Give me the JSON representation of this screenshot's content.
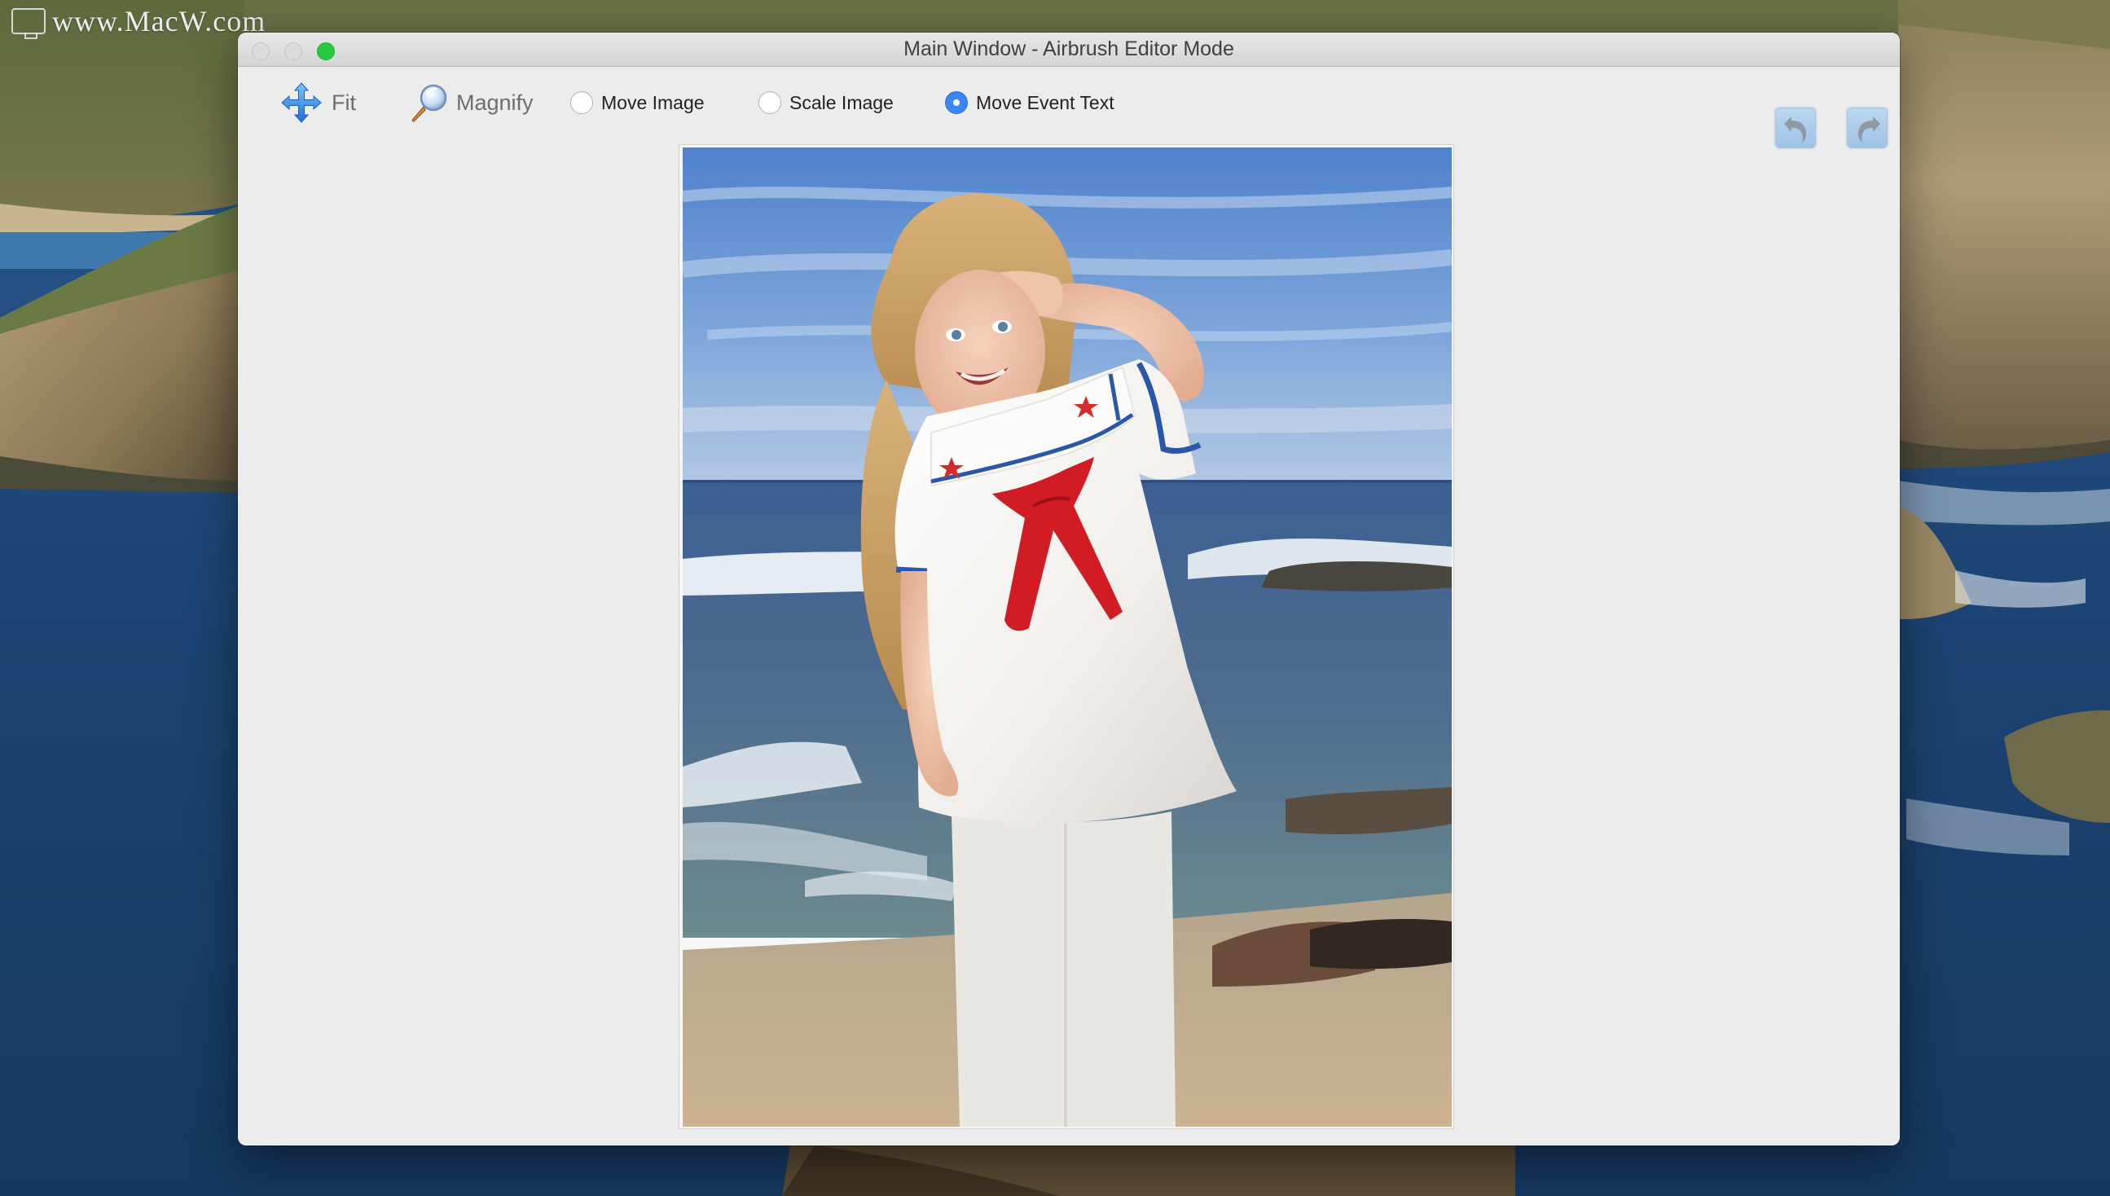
{
  "watermark": {
    "text": "www.MacW.com",
    "icon": "monitor-icon"
  },
  "window": {
    "title": "Main Window - Airbrush Editor Mode",
    "controls": [
      "close",
      "minimize",
      "zoom"
    ]
  },
  "toolbar": {
    "fit": {
      "label": "Fit",
      "icon": "four-way-arrows-icon"
    },
    "magnify": {
      "label": "Magnify",
      "icon": "magnifying-glass-icon"
    },
    "modes": [
      {
        "label": "Move Image",
        "checked": false
      },
      {
        "label": "Scale Image",
        "checked": false
      },
      {
        "label": "Move Event Text",
        "checked": true
      }
    ],
    "undo": {
      "icon": "undo-arrow-icon"
    },
    "redo": {
      "icon": "redo-arrow-icon"
    }
  },
  "canvas": {
    "photo_description": "Girl in white sailor dress with red neckerchief saluting on a beach"
  },
  "colors": {
    "accent": "#3a86f3",
    "window_bg": "#ececec",
    "zoom_button": "#28c941"
  }
}
